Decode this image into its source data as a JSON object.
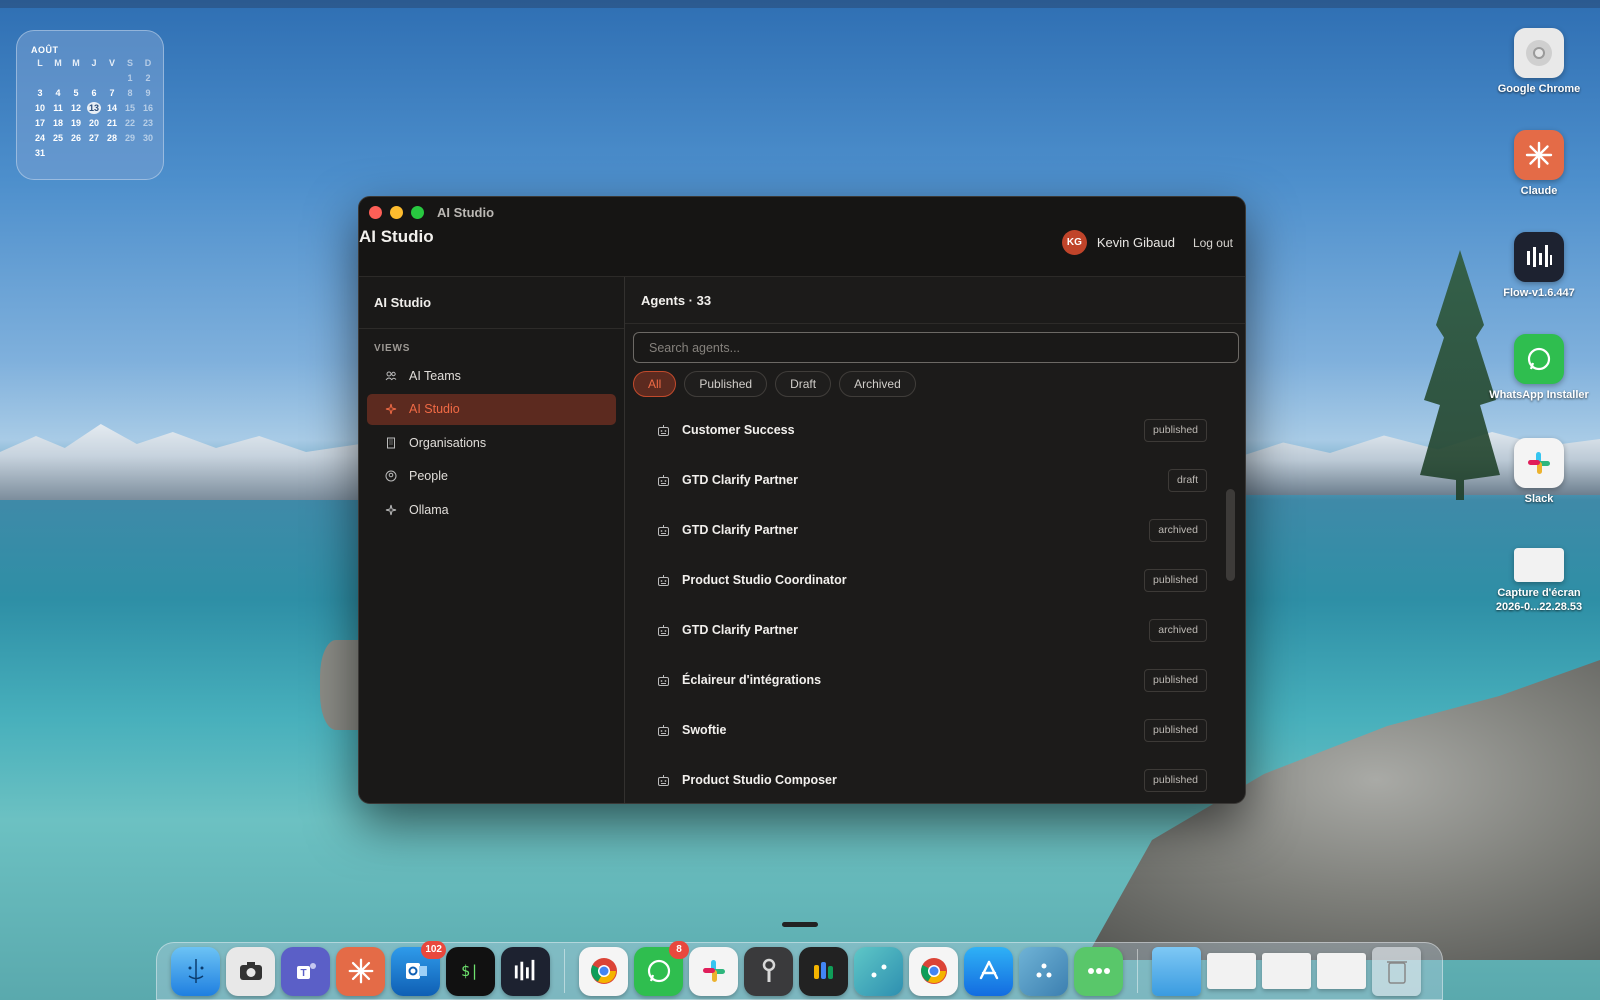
{
  "calendar": {
    "month": "AOÛT",
    "weekdays": [
      "L",
      "M",
      "M",
      "J",
      "V",
      "S",
      "D"
    ],
    "weeks": [
      [
        "",
        "",
        "",
        "",
        "",
        "1",
        "2"
      ],
      [
        "3",
        "4",
        "5",
        "6",
        "7",
        "8",
        "9"
      ],
      [
        "10",
        "11",
        "12",
        "13",
        "14",
        "15",
        "16"
      ],
      [
        "17",
        "18",
        "19",
        "20",
        "21",
        "22",
        "23"
      ],
      [
        "24",
        "25",
        "26",
        "27",
        "28",
        "29",
        "30"
      ],
      [
        "31",
        "",
        "",
        "",
        "",
        "",
        ""
      ]
    ],
    "today": "13"
  },
  "desktop_icons": [
    {
      "label": "Google Chrome",
      "icon": "chrome-icon"
    },
    {
      "label": "Claude",
      "icon": "claude-icon"
    },
    {
      "label": "Flow-v1.6.447",
      "icon": "flow-icon"
    },
    {
      "label": "WhatsApp Installer",
      "icon": "whatsapp-icon"
    },
    {
      "label": "Slack",
      "icon": "slack-icon"
    },
    {
      "label": "Capture d'écran 2026-0...22.28.53",
      "icon": "screenshot-file-icon"
    }
  ],
  "window": {
    "title": "AI Studio",
    "app_title": "AI Studio",
    "user": {
      "initials": "KG",
      "name": "Kevin Gibaud",
      "logout": "Log out"
    }
  },
  "sidebar": {
    "title": "AI Studio",
    "section": "VIEWS",
    "items": [
      {
        "label": "AI Teams",
        "icon": "teams-icon",
        "active": false
      },
      {
        "label": "AI Studio",
        "icon": "sparkle-icon",
        "active": true
      },
      {
        "label": "Organisations",
        "icon": "building-icon",
        "active": false
      },
      {
        "label": "People",
        "icon": "person-icon",
        "active": false
      },
      {
        "label": "Ollama",
        "icon": "sparkle-icon",
        "active": false
      }
    ]
  },
  "main": {
    "header": "Agents · 33",
    "search_placeholder": "Search agents...",
    "filters": [
      "All",
      "Published",
      "Draft",
      "Archived"
    ],
    "active_filter": "All",
    "agents": [
      {
        "name": "Customer Success",
        "status": "published"
      },
      {
        "name": "GTD Clarify Partner",
        "status": "draft"
      },
      {
        "name": "GTD Clarify Partner",
        "status": "archived"
      },
      {
        "name": "Product Studio Coordinator",
        "status": "published"
      },
      {
        "name": "GTD Clarify Partner",
        "status": "archived"
      },
      {
        "name": "Éclaireur d'intégrations",
        "status": "published"
      },
      {
        "name": "Swoftie",
        "status": "published"
      },
      {
        "name": "Product Studio Composer",
        "status": "published"
      }
    ]
  },
  "dock": {
    "apps": [
      {
        "name": "finder-icon",
        "badge": ""
      },
      {
        "name": "screenshot-app-icon",
        "badge": ""
      },
      {
        "name": "teams-app-icon",
        "badge": ""
      },
      {
        "name": "claude-app-icon",
        "badge": ""
      },
      {
        "name": "outlook-icon",
        "badge": "102"
      },
      {
        "name": "terminal-icon",
        "badge": ""
      },
      {
        "name": "flow-app-icon",
        "badge": ""
      },
      {
        "name": "chrome-app-icon",
        "badge": ""
      },
      {
        "name": "whatsapp-app-icon",
        "badge": "8"
      },
      {
        "name": "slack-app-icon",
        "badge": ""
      },
      {
        "name": "keychain-icon",
        "badge": ""
      },
      {
        "name": "cluster-app-icon",
        "badge": ""
      },
      {
        "name": "dots-app-icon",
        "badge": ""
      },
      {
        "name": "chrome-alt-icon",
        "badge": ""
      },
      {
        "name": "app-store-icon",
        "badge": ""
      },
      {
        "name": "triad-app-icon",
        "badge": ""
      },
      {
        "name": "more-app-icon",
        "badge": ""
      }
    ],
    "right": [
      {
        "name": "folder-icon"
      },
      {
        "name": "window-thumb-1"
      },
      {
        "name": "window-thumb-2"
      },
      {
        "name": "window-thumb-3"
      },
      {
        "name": "trash-icon"
      }
    ]
  },
  "colors": {
    "accent": "#f06a45",
    "accent_bg": "#5c2a1f",
    "window_bg": "#1c1b1a"
  }
}
